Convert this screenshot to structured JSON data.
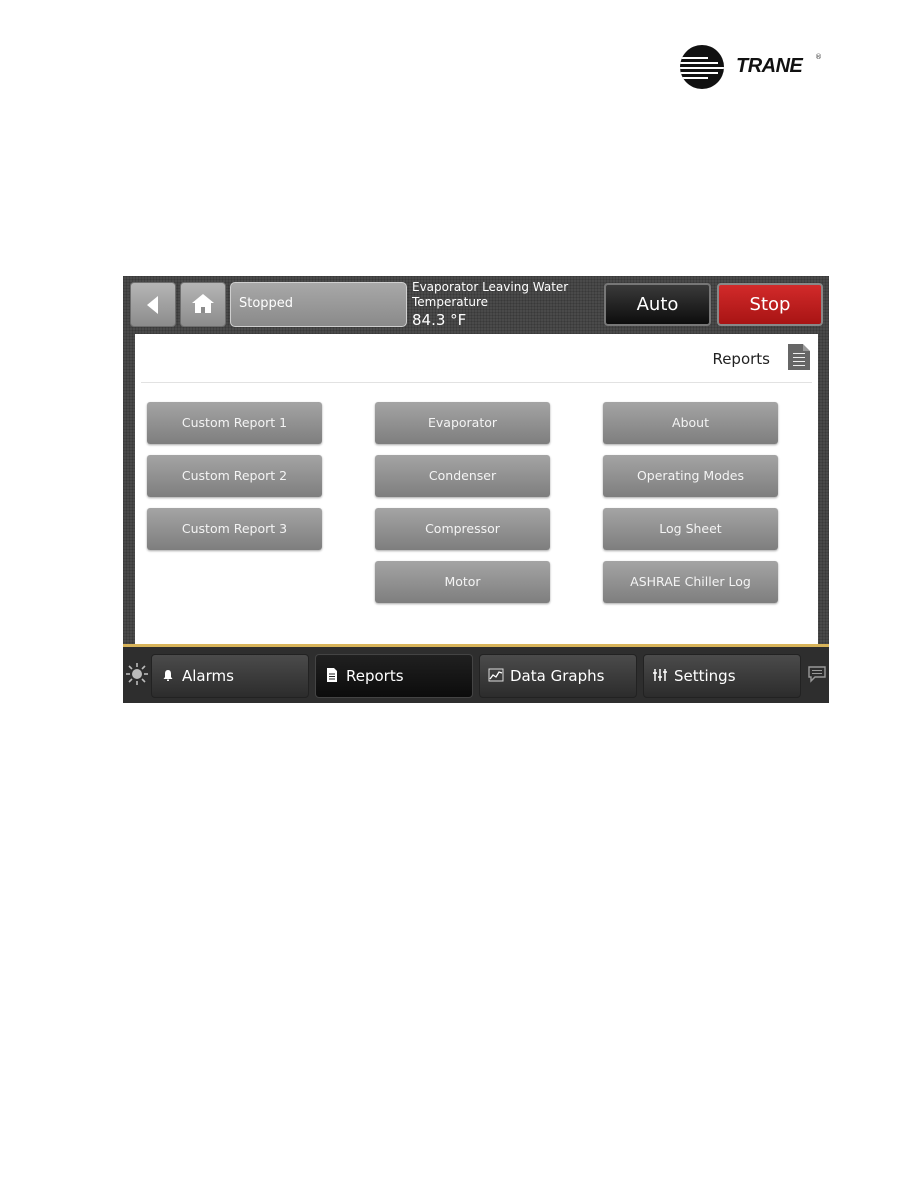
{
  "brand": {
    "name": "TRANE",
    "registered": "®"
  },
  "header": {
    "back_icon": "back-arrow-icon",
    "home_icon": "home-icon",
    "status": "Stopped",
    "temperature": {
      "label": "Evaporator Leaving Water Temperature",
      "value": "84.3 °F"
    },
    "auto_label": "Auto",
    "stop_label": "Stop",
    "colors": {
      "stop": "#c01e1e",
      "auto": "#111111"
    }
  },
  "page": {
    "title": "Reports",
    "title_icon": "document-icon"
  },
  "reports": {
    "column1": [
      "Custom Report 1",
      "Custom Report 2",
      "Custom Report 3"
    ],
    "column2": [
      "Evaporator",
      "Condenser",
      "Compressor",
      "Motor"
    ],
    "column3": [
      "About",
      "Operating Modes",
      "Log Sheet",
      "ASHRAE Chiller Log"
    ]
  },
  "footer": {
    "brightness_icon": "sun-icon",
    "tabs": [
      {
        "label": "Alarms",
        "icon": "bell-icon",
        "active": false
      },
      {
        "label": "Reports",
        "icon": "document-icon",
        "active": true
      },
      {
        "label": "Data Graphs",
        "icon": "graph-icon",
        "active": false
      },
      {
        "label": "Settings",
        "icon": "sliders-icon",
        "active": false
      }
    ],
    "chat_icon": "chat-icon",
    "accent": "#d8b45a"
  }
}
